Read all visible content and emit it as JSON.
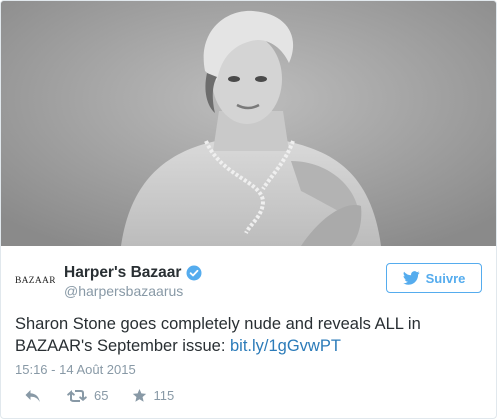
{
  "tweet": {
    "avatar_text": "BAZAAR",
    "display_name": "Harper's Bazaar",
    "handle": "@harpersbazaarus",
    "follow_label": "Suivre",
    "text_before_link": "Sharon Stone goes completely nude and reveals ALL in BAZAAR's September issue: ",
    "link_text": "bit.ly/1gGvwPT",
    "timestamp": "15:16 - 14 Août 2015",
    "retweet_count": "65",
    "like_count": "115"
  },
  "icons": {
    "verified": "verified-badge-icon",
    "follow": "twitter-bird-icon",
    "reply": "reply-icon",
    "retweet": "retweet-icon",
    "like": "star-icon"
  },
  "colors": {
    "accent": "#55acee",
    "link": "#2b7bb9",
    "muted": "#8899a6",
    "text": "#292f33"
  }
}
